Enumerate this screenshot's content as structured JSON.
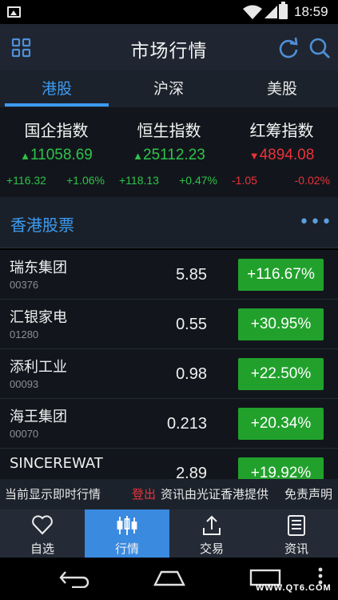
{
  "status_bar": {
    "time": "18:59"
  },
  "title_bar": {
    "title": "市场行情"
  },
  "tabs": [
    {
      "label": "港股",
      "active": true
    },
    {
      "label": "沪深",
      "active": false
    },
    {
      "label": "美股",
      "active": false
    }
  ],
  "indices": [
    {
      "name": "国企指数",
      "value": "11058.69",
      "arrow": "▲",
      "change": "+116.32",
      "percent": "+1.06%",
      "direction": "up"
    },
    {
      "name": "恒生指数",
      "value": "25112.23",
      "arrow": "▲",
      "change": "+118.13",
      "percent": "+0.47%",
      "direction": "up"
    },
    {
      "name": "红筹指数",
      "value": "4894.08",
      "arrow": "▼",
      "change": "-1.05",
      "percent": "-0.02%",
      "direction": "down"
    }
  ],
  "section": {
    "label": "香港股票",
    "more": "•••"
  },
  "stocks": [
    {
      "name": "瑞东集团",
      "code": "00376",
      "price": "5.85",
      "change_pct": "+116.67%"
    },
    {
      "name": "汇银家电",
      "code": "01280",
      "price": "0.55",
      "change_pct": "+30.95%"
    },
    {
      "name": "添利工业",
      "code": "00093",
      "price": "0.98",
      "change_pct": "+22.50%"
    },
    {
      "name": "海王集团",
      "code": "00070",
      "price": "0.213",
      "change_pct": "+20.34%"
    },
    {
      "name": "SINCEREWAT",
      "code": "",
      "price": "2.89",
      "change_pct": "+19.92%"
    }
  ],
  "ticker": {
    "notice": "当前显示即时行情",
    "logout": "登出",
    "provider": "资讯由光证香港提供",
    "disclaimer": "免责声明"
  },
  "bottom_nav": [
    {
      "label": "自选",
      "icon": "heart-icon",
      "active": false
    },
    {
      "label": "行情",
      "icon": "candlestick-icon",
      "active": true
    },
    {
      "label": "交易",
      "icon": "upload-icon",
      "active": false
    },
    {
      "label": "资讯",
      "icon": "news-icon",
      "active": false
    }
  ],
  "watermark": "WWW.QT6.COM",
  "colors": {
    "accent": "#3d9bf0",
    "up": "#2fc24a",
    "down": "#e8333a",
    "gain_badge": "#21a12c",
    "nav_active": "#3a8ae0"
  }
}
